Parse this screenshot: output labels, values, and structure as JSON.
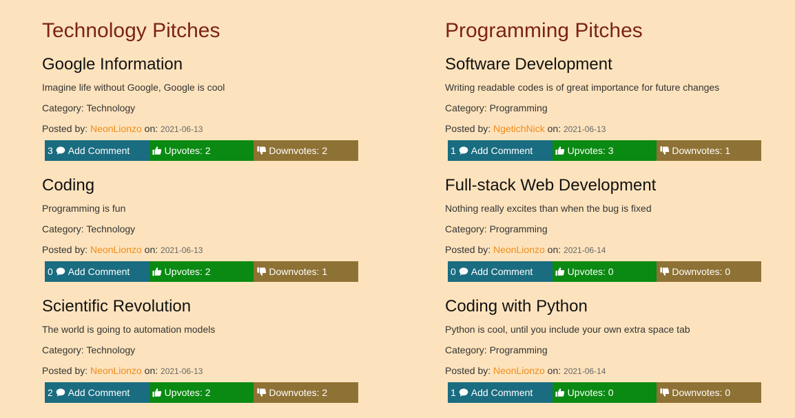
{
  "sections": [
    {
      "title": "Technology Pitches",
      "pitches": [
        {
          "title": "Google Information",
          "description": "Imagine life without Google, Google is cool",
          "category": "Category: Technology",
          "posted_prefix": "Posted by: ",
          "author": "NeonLionzo",
          "on_label": " on: ",
          "date": "2021-06-13",
          "comment_count": "3",
          "comment_label": "Add Comment",
          "upvotes": "Upvotes: 2",
          "downvotes": "Downvotes: 2"
        },
        {
          "title": "Coding",
          "description": "Programming is fun",
          "category": "Category: Technology",
          "posted_prefix": "Posted by: ",
          "author": "NeonLionzo",
          "on_label": " on: ",
          "date": "2021-06-13",
          "comment_count": "0",
          "comment_label": "Add Comment",
          "upvotes": "Upvotes: 2",
          "downvotes": "Downvotes: 1"
        },
        {
          "title": "Scientific Revolution",
          "description": "The world is going to automation models",
          "category": "Category: Technology",
          "posted_prefix": "Posted by: ",
          "author": "NeonLionzo",
          "on_label": " on: ",
          "date": "2021-06-13",
          "comment_count": "2",
          "comment_label": "Add Comment",
          "upvotes": "Upvotes: 2",
          "downvotes": "Downvotes: 2"
        }
      ]
    },
    {
      "title": "Programming Pitches",
      "pitches": [
        {
          "title": "Software Development",
          "description": "Writing readable codes is of great importance for future changes",
          "category": "Category: Programming",
          "posted_prefix": "Posted by: ",
          "author": "NgetichNick",
          "on_label": " on: ",
          "date": "2021-06-13",
          "comment_count": "1",
          "comment_label": "Add Comment",
          "upvotes": "Upvotes: 3",
          "downvotes": "Downvotes: 1"
        },
        {
          "title": "Full-stack Web Development",
          "description": "Nothing really excites than when the bug is fixed",
          "category": "Category: Programming",
          "posted_prefix": "Posted by: ",
          "author": "NeonLionzo",
          "on_label": " on: ",
          "date": "2021-06-14",
          "comment_count": "0",
          "comment_label": "Add Comment",
          "upvotes": "Upvotes: 0",
          "downvotes": "Downvotes: 0"
        },
        {
          "title": "Coding with Python",
          "description": "Python is cool, until you include your own extra space tab",
          "category": "Category: Programming",
          "posted_prefix": "Posted by: ",
          "author": "NeonLionzo",
          "on_label": " on: ",
          "date": "2021-06-14",
          "comment_count": "1",
          "comment_label": "Add Comment",
          "upvotes": "Upvotes: 0",
          "downvotes": "Downvotes: 0"
        }
      ]
    }
  ],
  "icons": {
    "comment": "comment-icon",
    "upvote": "thumbs-up-icon",
    "downvote": "thumbs-down-icon"
  },
  "colors": {
    "background": "#fde3bd",
    "section_title": "#7b2316",
    "author_link": "#f08b1a",
    "comment_bar": "#1a6c80",
    "upvote_bar": "#0a8a12",
    "downvote_bar": "#8e7134"
  }
}
